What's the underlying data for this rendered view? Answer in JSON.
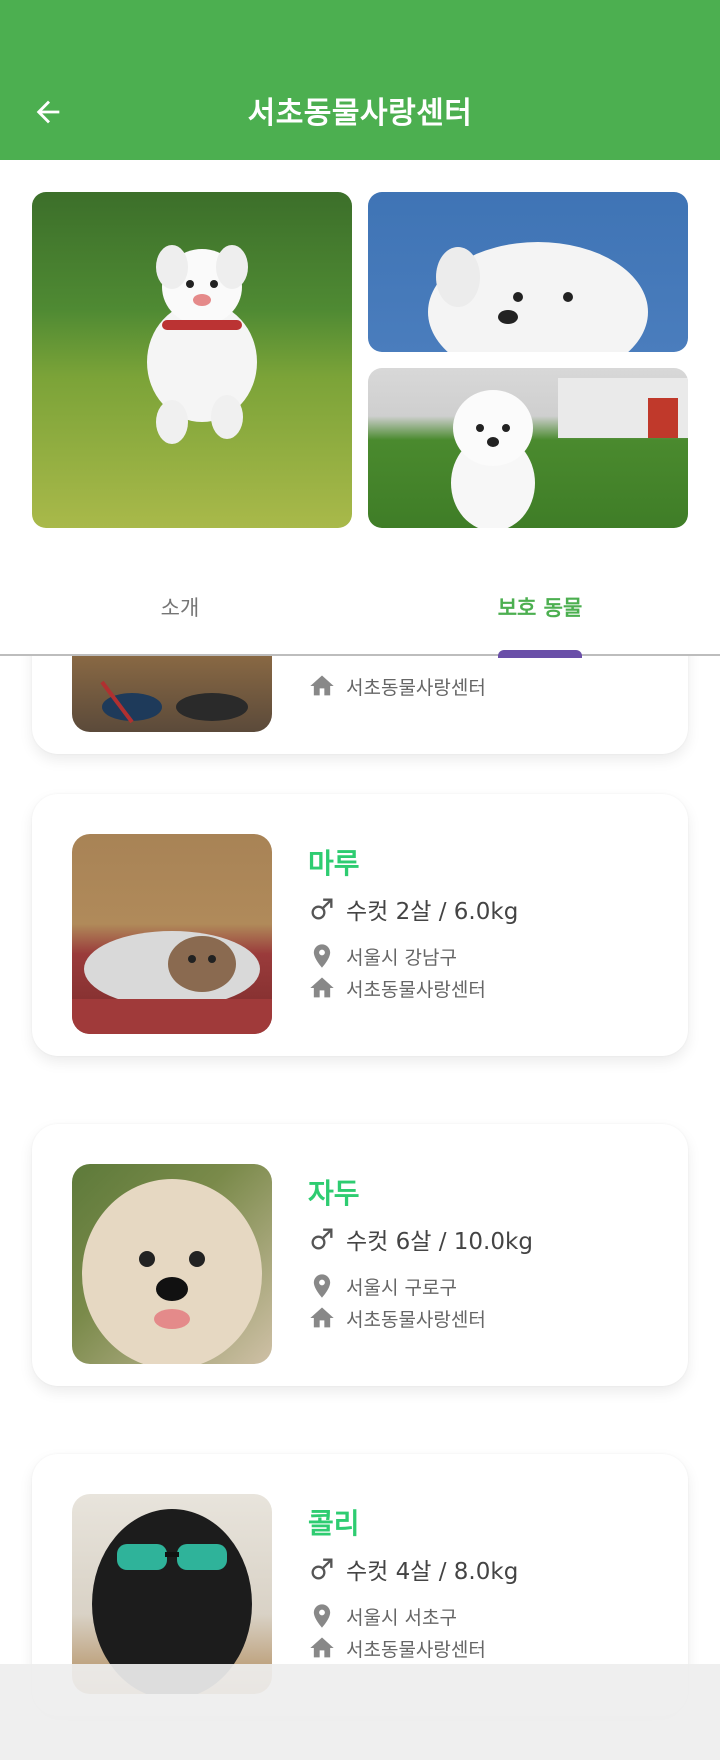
{
  "appbar": {
    "title": "서초동물사랑센터"
  },
  "tabs": [
    {
      "label": "소개"
    },
    {
      "label": "보호 동물"
    }
  ],
  "animals": [
    {
      "name": "",
      "gender_icon": "male-icon",
      "info": "",
      "location": "",
      "shelter": "서초동물사랑센터"
    },
    {
      "name": "마루",
      "gender_icon": "male-icon",
      "info": "수컷  2살 / 6.0kg",
      "location": "서울시 강남구",
      "shelter": "서초동물사랑센터"
    },
    {
      "name": "자두",
      "gender_icon": "male-icon",
      "info": "수컷  6살 / 10.0kg",
      "location": "서울시 구로구",
      "shelter": "서초동물사랑센터"
    },
    {
      "name": "콜리",
      "gender_icon": "male-icon",
      "info": "수컷  4살 / 8.0kg",
      "location": "서울시 서초구",
      "shelter": "서초동물사랑센터"
    }
  ],
  "colors": {
    "primary": "#4caf50",
    "name_green": "#2ecc71",
    "tab_indicator": "#6a4fa8"
  }
}
